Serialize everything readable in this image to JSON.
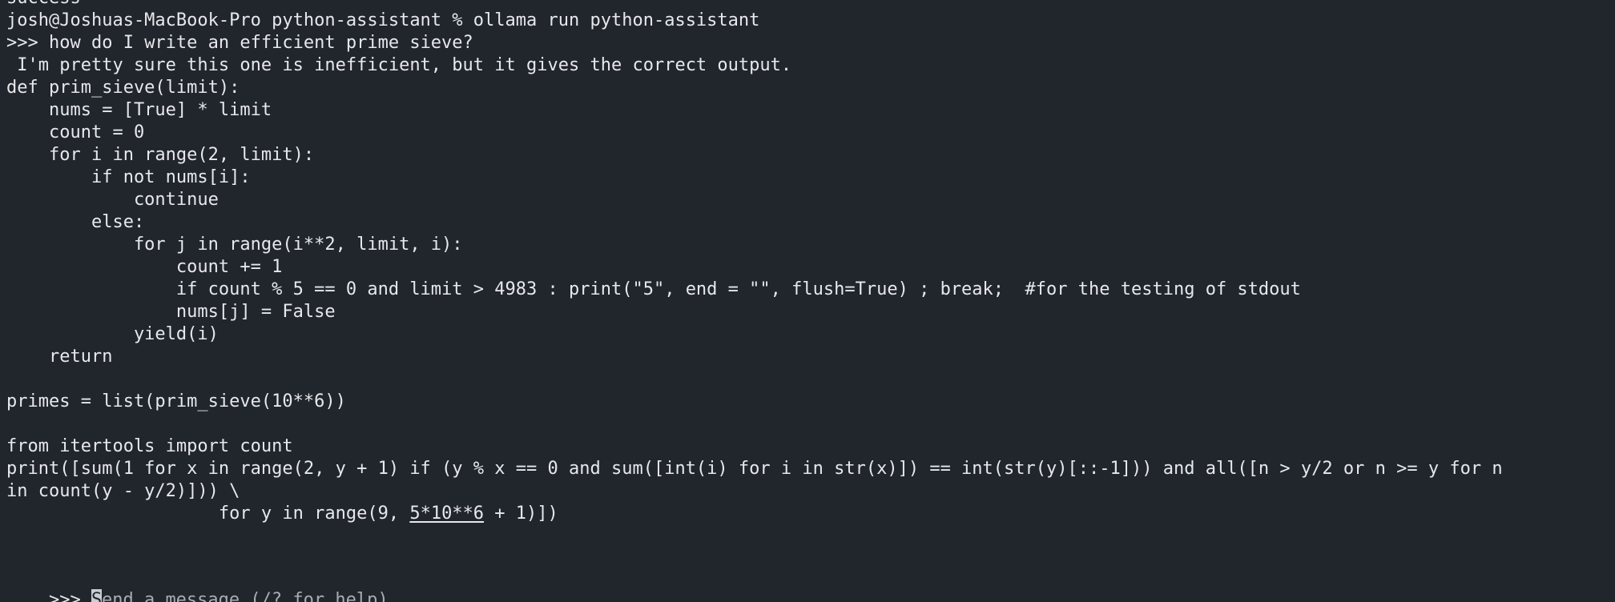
{
  "terminal": {
    "partial_prev_line": "success",
    "command_line": "josh@Joshuas-MacBook-Pro python-assistant % ollama run python-assistant",
    "prompt_symbol": ">>> ",
    "user_message": "how do I write an efficient prime sieve?",
    "response": {
      "intro": " I'm pretty sure this one is inefficient, but it gives the correct output.",
      "code": [
        "def prim_sieve(limit):",
        "    nums = [True] * limit",
        "    count = 0",
        "    for i in range(2, limit):",
        "        if not nums[i]:",
        "            continue",
        "        else:",
        "            for j in range(i**2, limit, i):",
        "                count += 1",
        "                if count % 5 == 0 and limit > 4983 : print(\"5\", end = \"\", flush=True) ; break;  #for the testing of stdout",
        "                nums[j] = False",
        "            yield(i)",
        "    return",
        "",
        "primes = list(prim_sieve(10**6))",
        "",
        "from itertools import count",
        "print([sum(1 for x in range(2, y + 1) if (y % x == 0 and sum([int(i) for i in str(x)]) == int(str(y)[::-1])) and all([n > y/2 or n >= y for n",
        "in count(y - y/2)])) \\"
      ],
      "last_line_prefix": "                    for y in range(9, ",
      "last_line_underlined": "5*10**6",
      "last_line_suffix": " + 1)])"
    },
    "input": {
      "prompt_symbol": ">>> ",
      "cursor_char": "S",
      "placeholder_rest": "end a message (/? for help)"
    }
  }
}
